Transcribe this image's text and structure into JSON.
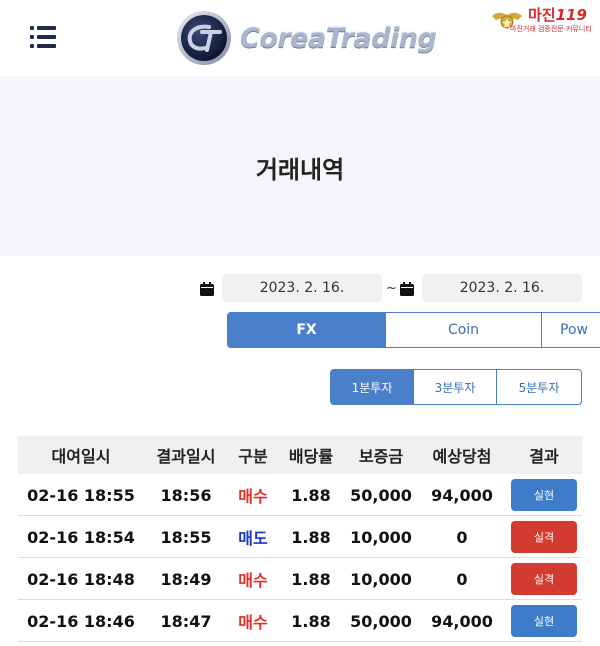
{
  "header": {
    "logo_text": "CoreaTrading",
    "badge_title": "마진",
    "badge_number": "119",
    "badge_subtitle": "마진거래 검증전문 커뮤니티"
  },
  "page": {
    "title": "거래내역"
  },
  "filters": {
    "start_date": "2023. 2. 16.",
    "separator": "~",
    "end_date": "2023. 2. 16."
  },
  "market_tabs": [
    {
      "label": "FX",
      "active": true
    },
    {
      "label": "Coin",
      "active": false
    },
    {
      "label": "Pow",
      "active": false
    }
  ],
  "duration_tabs": [
    {
      "label": "1분투자",
      "active": true
    },
    {
      "label": "3분투자",
      "active": false
    },
    {
      "label": "5분투자",
      "active": false
    }
  ],
  "table": {
    "headers": [
      "대여일시",
      "결과일시",
      "구분",
      "배당률",
      "보증금",
      "예상당첨",
      "결과"
    ],
    "rows": [
      {
        "time": "02-16 18:55",
        "result_time": "18:56",
        "type": "매수",
        "odds": "1.88",
        "deposit": "50,000",
        "expected": "94,000",
        "result": "실현"
      },
      {
        "time": "02-16 18:54",
        "result_time": "18:55",
        "type": "매도",
        "odds": "1.88",
        "deposit": "10,000",
        "expected": "0",
        "result": "실격"
      },
      {
        "time": "02-16 18:48",
        "result_time": "18:49",
        "type": "매수",
        "odds": "1.88",
        "deposit": "10,000",
        "expected": "0",
        "result": "실격"
      },
      {
        "time": "02-16 18:46",
        "result_time": "18:47",
        "type": "매수",
        "odds": "1.88",
        "deposit": "50,000",
        "expected": "94,000",
        "result": "실현"
      }
    ]
  },
  "colors": {
    "accent": "#4a80c9",
    "buy": "#e0302b",
    "sell": "#1736c8",
    "win": "#3d7cc9",
    "lose": "#d33a30",
    "title_band": "#f6f5fa"
  },
  "icons": {
    "menu": "menu-icon",
    "calendar": "calendar-icon",
    "logo": "logo-emblem-icon"
  }
}
